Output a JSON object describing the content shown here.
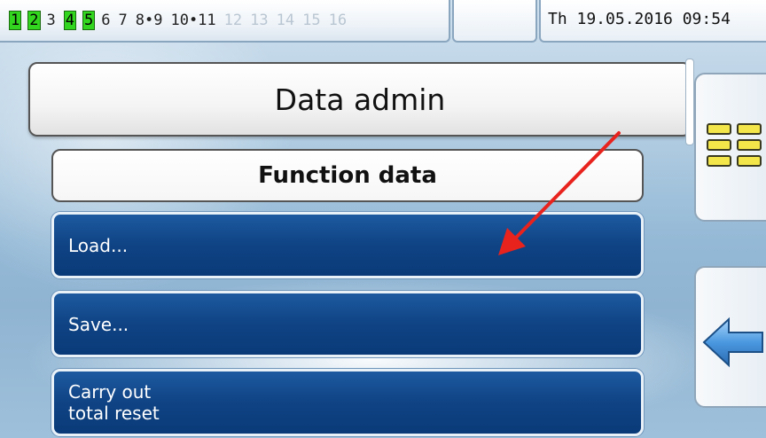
{
  "status_bar": {
    "outputs": [
      {
        "label": "1",
        "state": "on"
      },
      {
        "label": "2",
        "state": "on"
      },
      {
        "label": "3",
        "state": "off"
      },
      {
        "label": "4",
        "state": "on"
      },
      {
        "label": "5",
        "state": "on"
      },
      {
        "label": "6",
        "state": "off"
      },
      {
        "label": "7",
        "state": "off"
      },
      {
        "label": "8•9",
        "state": "off"
      },
      {
        "label": "10•11",
        "state": "off"
      },
      {
        "label": "12",
        "state": "disabled"
      },
      {
        "label": "13",
        "state": "disabled"
      },
      {
        "label": "14",
        "state": "disabled"
      },
      {
        "label": "15",
        "state": "disabled"
      },
      {
        "label": "16",
        "state": "disabled"
      }
    ],
    "datetime": "Th 19.05.2016 09:54"
  },
  "page": {
    "title": "Data admin",
    "subtitle": "Function data"
  },
  "menu": {
    "load_label": "Load...",
    "save_label": "Save...",
    "reset_line1": "Carry out",
    "reset_line2": "total reset"
  },
  "side_buttons": {
    "menu_icon": "menu-grid-icon",
    "back_icon": "back-arrow-icon"
  },
  "colors": {
    "output_on": "#33d61f",
    "menu_button": "#0f4384",
    "annotation_arrow": "#e8231e",
    "menu_icon_fill": "#f3e64a",
    "back_icon_fill": "#5aa6e8"
  }
}
